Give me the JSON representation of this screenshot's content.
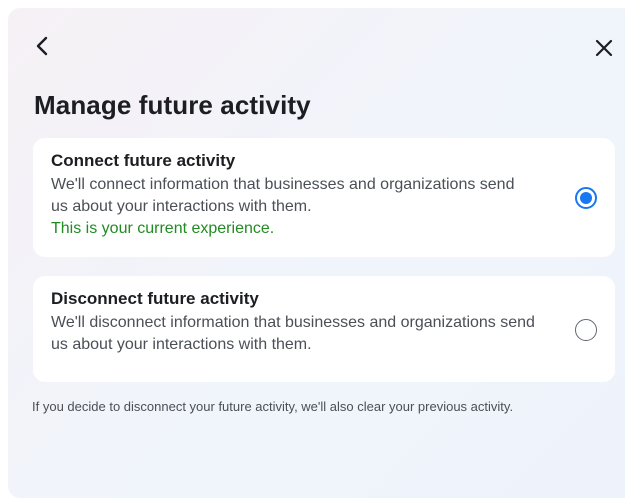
{
  "header": {
    "back_icon": "chevron-left-icon",
    "close_icon": "close-icon",
    "title": "Manage future activity"
  },
  "options": [
    {
      "title": "Connect future activity",
      "description": "We'll connect information that businesses and organizations send us about your interactions with them.",
      "current_note": "This is your current experience.",
      "selected": true
    },
    {
      "title": "Disconnect future activity",
      "description": "We'll disconnect information that businesses and organizations send us about your interactions with them.",
      "selected": false
    }
  ],
  "footnote": "If you decide to disconnect your future activity, we'll also clear your previous activity.",
  "colors": {
    "accent": "#1877f2",
    "current_note": "#228b22",
    "title_text": "#1c1e21"
  }
}
